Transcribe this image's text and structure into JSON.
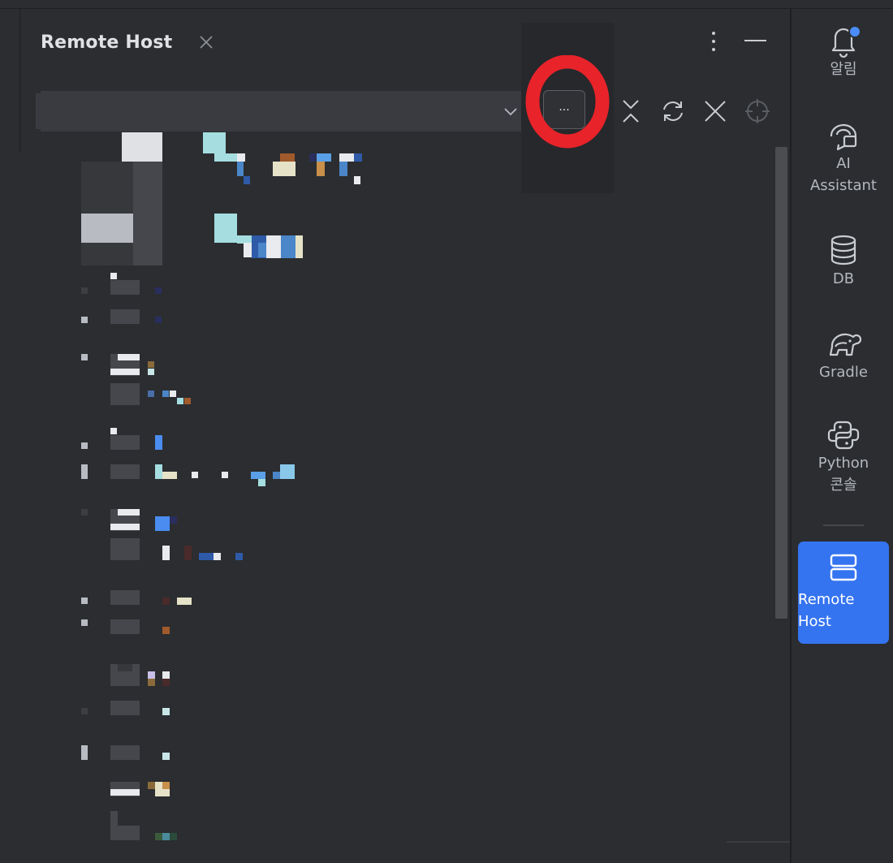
{
  "panel": {
    "title": "Remote Host",
    "host_select": {
      "value": "",
      "browse_label": "..."
    },
    "annotation_mark": "O"
  },
  "toolbar": {
    "icons": [
      "collapse-all-icon",
      "refresh-icon",
      "disconnect-icon",
      "locate-icon"
    ]
  },
  "sidebar": {
    "items": [
      {
        "label": "알림",
        "icon": "bell-icon",
        "has_badge": true
      },
      {
        "label": "AI\nAssistant",
        "icon": "ai-assistant-icon"
      },
      {
        "label": "DB",
        "icon": "database-icon"
      },
      {
        "label": "Gradle",
        "icon": "gradle-icon"
      },
      {
        "label": "Python\n콘솔",
        "icon": "python-icon"
      },
      {
        "label": "Remote\nHost",
        "icon": "remote-host-icon",
        "active": true
      }
    ]
  },
  "colors": {
    "background": "#2b2d30",
    "accent": "#3574f0",
    "annotation": "#e8232a",
    "input_bg": "#393b40"
  }
}
